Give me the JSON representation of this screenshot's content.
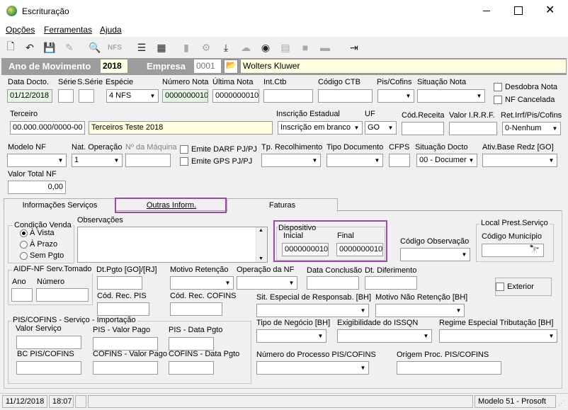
{
  "window": {
    "title": "Escrituração"
  },
  "menu": [
    "Opções",
    "Ferramentas",
    "Ajuda"
  ],
  "header": {
    "ano_label": "Ano de Movimento",
    "ano_value": "2018",
    "empresa_label": "Empresa",
    "empresa_code": "0001",
    "empresa_name": "Wolters Kluwer"
  },
  "row1": {
    "data_docto_label": "Data Docto.",
    "data_docto_value": "01/12/2018",
    "serie_label": "Série",
    "sserie_label": "S.Série",
    "especie_label": "Espécie",
    "especie_value": "4 NFS",
    "numero_nota_label": "Número Nota",
    "numero_nota_value": "0000000010",
    "ultima_nota_label": "Última Nota",
    "ultima_nota_value": "0000000010",
    "int_ctb_label": "Int.Ctb",
    "codigo_ctb_label": "Código CTB",
    "pis_cofins_label": "Pis/Cofins",
    "situacao_nota_label": "Situação Nota",
    "desdobra_nota_label": "Desdobra Nota",
    "nf_cancelada_label": "NF Cancelada"
  },
  "row2": {
    "terceiro_label": "Terceiro",
    "terceiro_cnpj": "00.000.000/0000-00",
    "terceiro_name": "Terceiros Teste 2018",
    "inscricao_label": "Inscrição Estadual",
    "inscricao_value": "Inscrição em branco",
    "uf_label": "UF",
    "uf_value": "GO",
    "cod_receita_label": "Cód.Receita",
    "valor_irrf_label": "Valor I.R.R.F.",
    "ret_irrf_label": "Ret.Irrf/Pis/Cofins",
    "ret_irrf_value": "0-Nenhum"
  },
  "row3": {
    "modelo_nf_label": "Modelo NF",
    "nat_operacao_label": "Nat. Operação",
    "nat_operacao_value": "1",
    "num_maquina_label": "Nº da Máquina",
    "emite_darf_label": "Emite DARF PJ/PJ",
    "emite_gps_label": "Emite GPS PJ/PJ",
    "tp_recolhimento_label": "Tp. Recolhimento",
    "tipo_documento_label": "Tipo Documento",
    "cfps_label": "CFPS",
    "situacao_docto_label": "Situação Docto",
    "situacao_docto_value": "00 - Documer",
    "ativ_base_label": "Ativ.Base Redz [GO]"
  },
  "row4": {
    "valor_total_label": "Valor Total NF",
    "valor_total_value": "0,00"
  },
  "tabs": [
    "Informações Serviços",
    "Outras Inform.",
    "Faturas"
  ],
  "outras": {
    "condicao_venda_title": "Condição Venda",
    "radio_options": [
      "À Vista",
      "À Prazo",
      "Sem Pgto"
    ],
    "observacoes_label": "Observações",
    "dispositivo_title": "Dispositivo",
    "inicial_label": "Inicial",
    "inicial_value": "0000000010",
    "final_label": "Final",
    "final_value": "0000000010",
    "codigo_observacao_label": "Código Observação",
    "local_prest_title": "Local Prest.Serviço",
    "codigo_municipio_label": "Código Município",
    "aidf_title": "AIDF-NF Serv.Tomado",
    "ano_label": "Ano",
    "numero_label": "Número",
    "dt_pgto_label": "Dt.Pgto [GO]/[RJ]",
    "motivo_retencao_label": "Motivo Retenção",
    "operacao_nf_label": "Operação da NF",
    "data_conclusao_label": "Data Conclusão",
    "dt_diferimento_label": "Dt. Diferimento",
    "exterior_label": "Exterior",
    "cod_rec_pis_label": "Cód. Rec. PIS",
    "cod_rec_cofins_label": "Cód. Rec. COFINS",
    "sit_especial_label": "Sit. Especial de Responsab. [BH]",
    "motivo_nao_retencao_label": "Motivo Não Retenção [BH]",
    "piscofins_title": "PIS/COFINS - Serviço - Importação",
    "valor_servico_label": "Valor Serviço",
    "pis_valor_pago_label": "PIS - Valor Pago",
    "pis_data_pgto_label": "PIS - Data Pgto",
    "bc_piscofins_label": "BC PIS/COFINS",
    "cofins_valor_pago_label": "COFINS - Valor Pago",
    "cofins_data_pgto_label": "COFINS - Data Pgto",
    "tipo_negocio_label": "Tipo de Negócio [BH]",
    "exigibilidade_label": "Exigibilidade do ISSQN",
    "regime_especial_label": "Regime Especial Tributação [BH]",
    "numero_processo_label": "Número do Processo PIS/COFINS",
    "origem_proc_label": "Origem Proc. PIS/COFINS"
  },
  "status": {
    "date": "11/12/2018",
    "time": "18:07",
    "model": "Modelo 51 - Prosoft"
  },
  "colors": {
    "highlight": "#9b4da6",
    "header_band": "#9c9c9c",
    "yellow_field": "#ffffe1",
    "green_field": "#e6f7e6"
  }
}
